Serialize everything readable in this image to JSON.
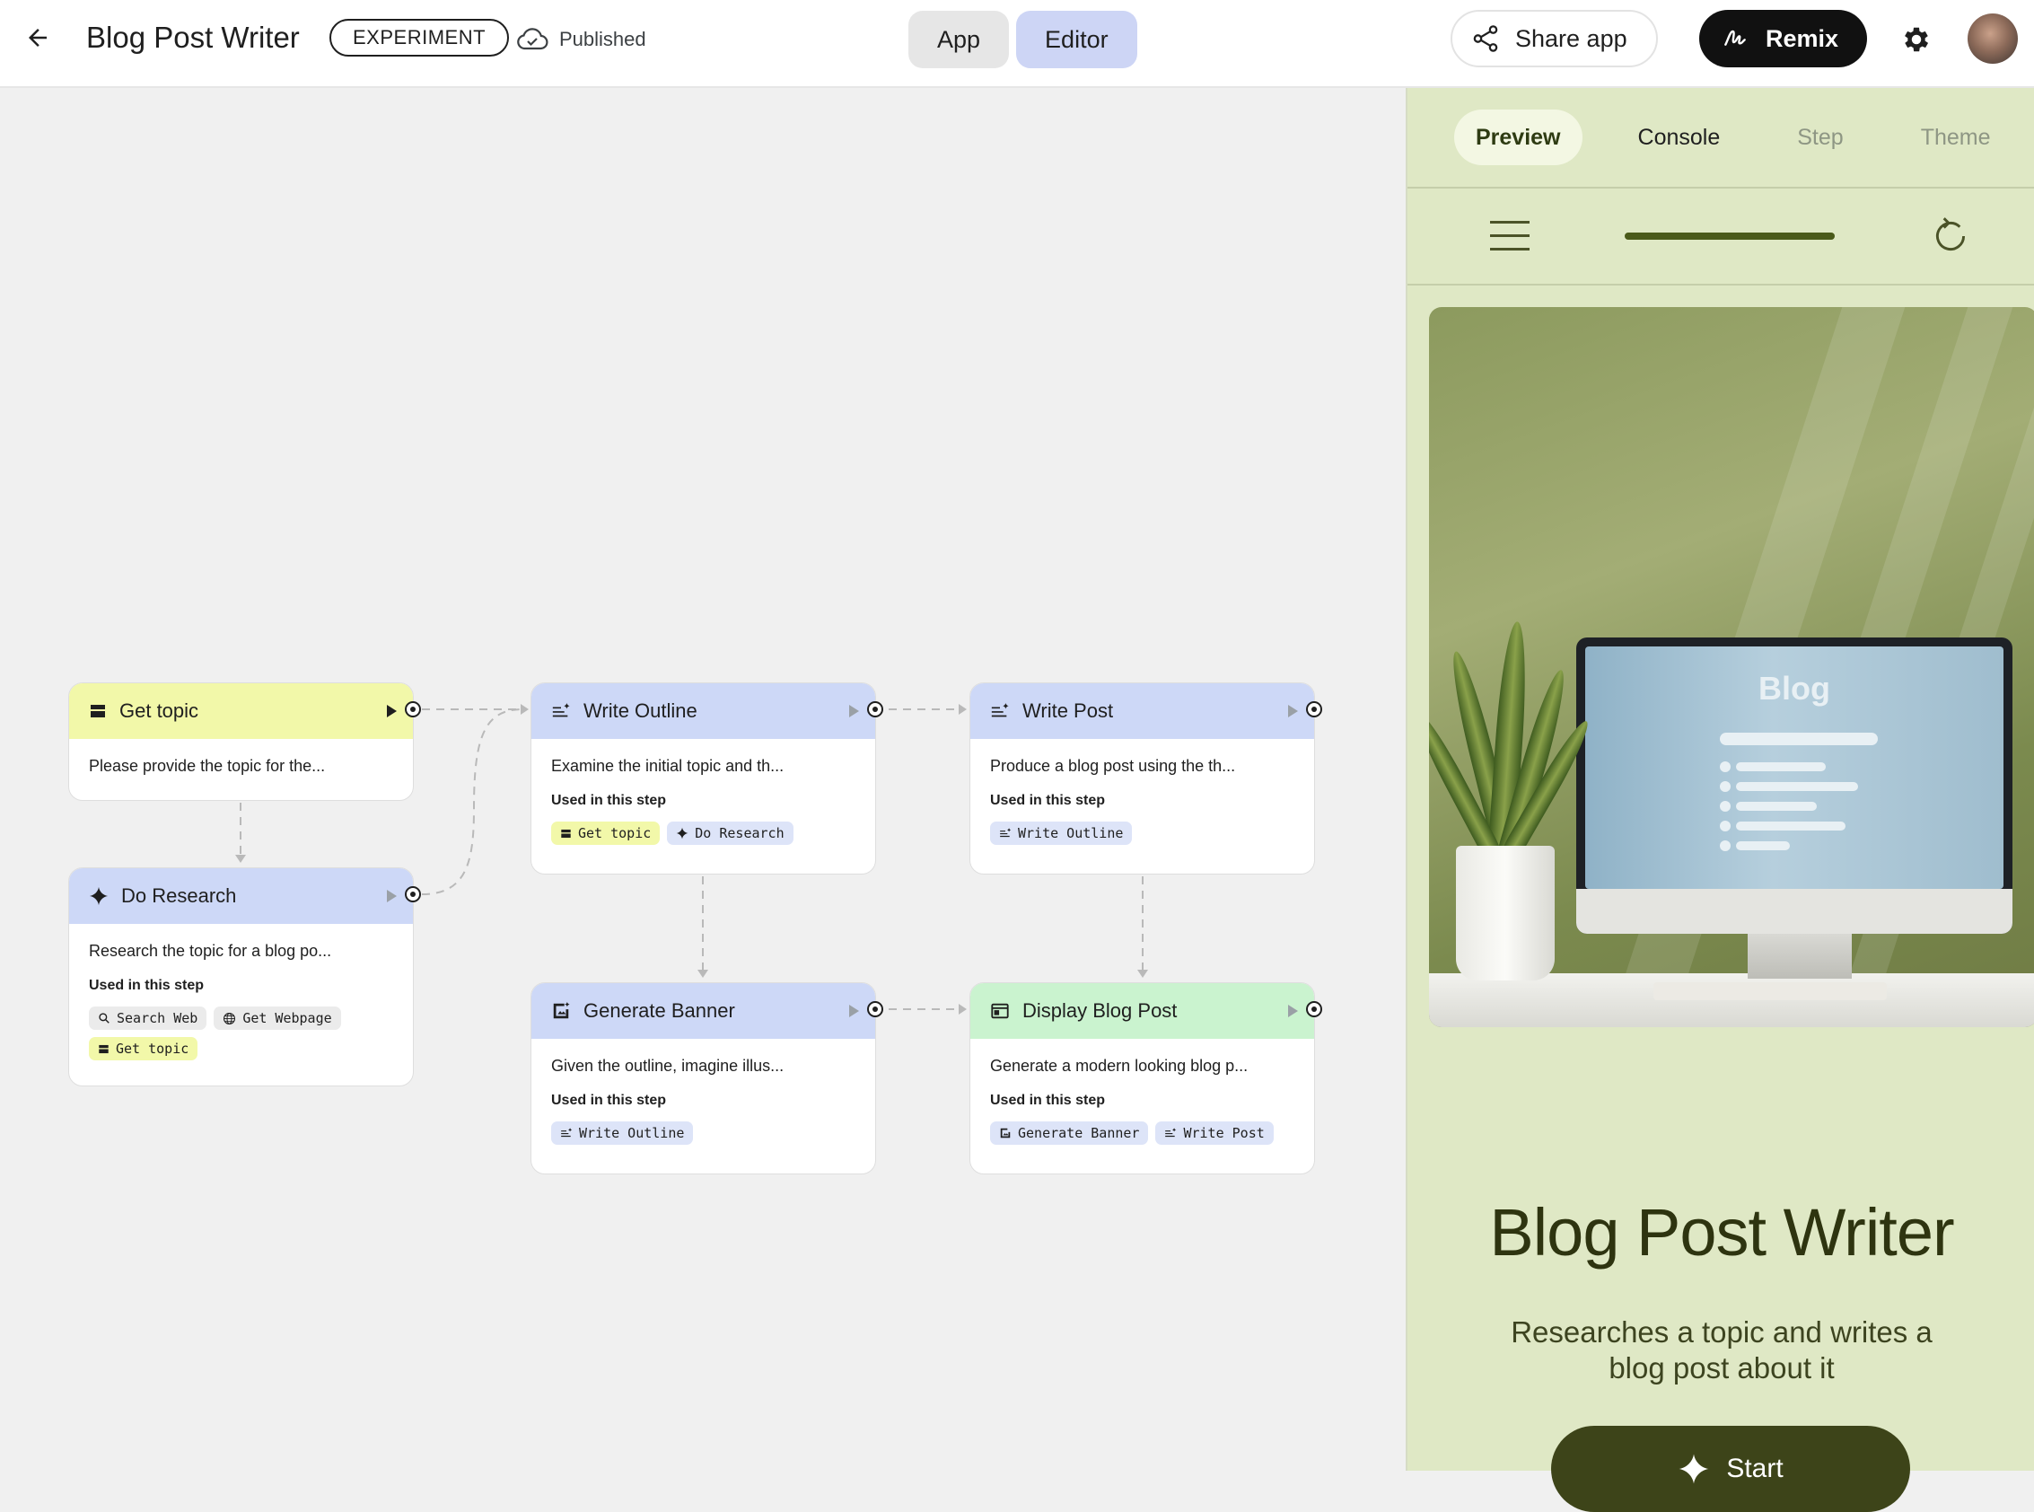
{
  "header": {
    "title": "Blog Post Writer",
    "badge": "EXPERIMENT",
    "status": "Published",
    "modes": [
      "App",
      "Editor"
    ],
    "active_mode": "Editor",
    "share_label": "Share app",
    "remix_label": "Remix"
  },
  "nodes": {
    "get_topic": {
      "title": "Get topic",
      "desc": "Please provide the topic for the..."
    },
    "do_research": {
      "title": "Do Research",
      "desc": "Research the topic for a blog po...",
      "used_label": "Used in this step",
      "chips": [
        "Search Web",
        "Get Webpage",
        "Get topic"
      ]
    },
    "write_outline": {
      "title": "Write Outline",
      "desc": "Examine the initial topic and th...",
      "used_label": "Used in this step",
      "chips": [
        "Get topic",
        "Do Research"
      ]
    },
    "write_post": {
      "title": "Write Post",
      "desc": "Produce a blog post using the th...",
      "used_label": "Used in this step",
      "chips": [
        "Write Outline"
      ]
    },
    "generate_banner": {
      "title": "Generate Banner",
      "desc": "Given the outline, imagine illus...",
      "used_label": "Used in this step",
      "chips": [
        "Write Outline"
      ]
    },
    "display_blog_post": {
      "title": "Display Blog Post",
      "desc": "Generate a modern looking blog p...",
      "used_label": "Used in this step",
      "chips": [
        "Generate Banner",
        "Write Post"
      ]
    }
  },
  "preview": {
    "tabs": [
      "Preview",
      "Console",
      "Step",
      "Theme"
    ],
    "active_tab": "Preview",
    "progress": 1.0,
    "hero_screen_text": "Blog",
    "title": "Blog Post Writer",
    "description": "Researches a topic and writes a blog post about it",
    "start_label": "Start"
  },
  "colors": {
    "node_yellow": "#f2f8a9",
    "node_blue": "#cdd8f7",
    "node_green": "#caf3cf",
    "panel_bg": "#dfe8c5",
    "start_button": "#3d4419"
  },
  "icons": {
    "back": "arrow-left-icon",
    "published": "cloud-check-icon",
    "share": "share-icon",
    "remix": "remix-icon",
    "settings": "gear-icon",
    "menu": "hamburger-icon",
    "refresh": "refresh-icon",
    "start": "sparkle-icon"
  }
}
